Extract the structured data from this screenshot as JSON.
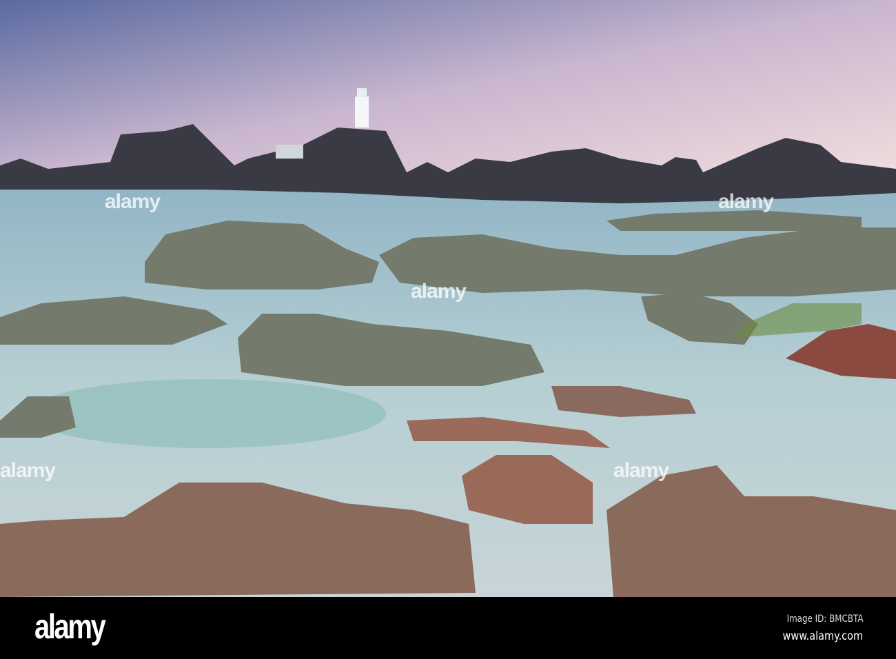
{
  "watermark": {
    "logo_text": "alamy",
    "overlay_text": "alamy"
  },
  "footer": {
    "logo": "alamy",
    "image_id": "Image ID: BMCBTA",
    "url": "www.alamy.com"
  },
  "colors": {
    "sky_top": "#5d6a9c",
    "sky_bottom": "#e8cfd6",
    "sea": "#a9c6cf",
    "rock": "#6f7468",
    "footer_bg": "#000000"
  }
}
